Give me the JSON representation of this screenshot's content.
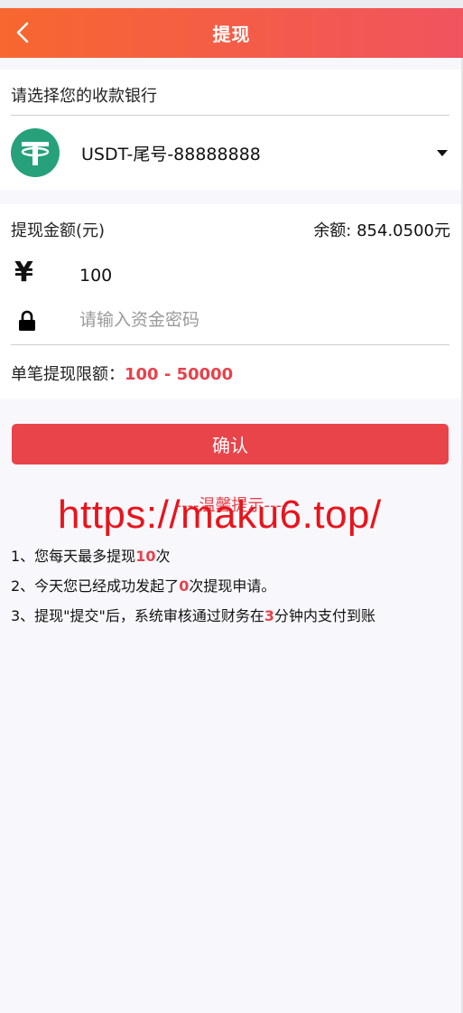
{
  "header": {
    "title": "提现"
  },
  "bank": {
    "label": "请选择您的收款银行",
    "selected": "USDT-尾号-88888888"
  },
  "amount": {
    "label": "提现金额(元)",
    "balance": "余额: 854.0500元",
    "currency_symbol": "¥",
    "value": "100",
    "password_placeholder": "请输入资金密码",
    "limit_label": "单笔提现限额：",
    "limit_value": "100 - 50000"
  },
  "confirm_label": "确认",
  "tips": {
    "title": "----温馨提示----",
    "watermark": "https://maku6.top/",
    "items": [
      {
        "prefix": "1、您每天最多提现",
        "highlight": "10",
        "suffix": "次"
      },
      {
        "prefix": "2、今天您已经成功发起了",
        "highlight": "0",
        "suffix": "次提现申请。"
      },
      {
        "prefix": "3、提现\"提交\"后，系统审核通过财务在",
        "highlight": "3",
        "suffix": "分钟内支付到账"
      }
    ]
  },
  "colors": {
    "accent": "#e8444a",
    "header_start": "#f7672f",
    "header_end": "#f1535f",
    "usdt": "#26a17b"
  },
  "icons": {
    "back": "chevron-left-icon",
    "bank_logo": "usdt-tether-icon",
    "dropdown": "caret-down-icon",
    "lock": "lock-icon"
  }
}
